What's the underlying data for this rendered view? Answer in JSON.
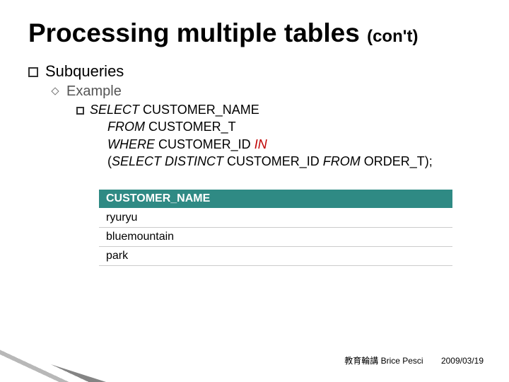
{
  "title_main": "Processing multiple tables",
  "title_cont": "(con't)",
  "bullet1": "Subqueries",
  "bullet2": "Example",
  "sql": {
    "select": "SELECT",
    "col": " CUSTOMER_NAME",
    "from": "FROM",
    "tbl1": " CUSTOMER_T",
    "where": "WHERE ",
    "whcol": " CUSTOMER_ID ",
    "in": "IN",
    "open": "(",
    "selectd": "SELECT DISTINCT ",
    "col2": " CUSTOMER_ID ",
    "from2": "FROM ",
    "tbl2": " ORDER_T);"
  },
  "table": {
    "header": "CUSTOMER_NAME",
    "rows": [
      "ryuryu",
      "bluemountain",
      "park"
    ]
  },
  "footer": {
    "author": "教育輪講   Brice Pesci",
    "date": "2009/03/19"
  }
}
